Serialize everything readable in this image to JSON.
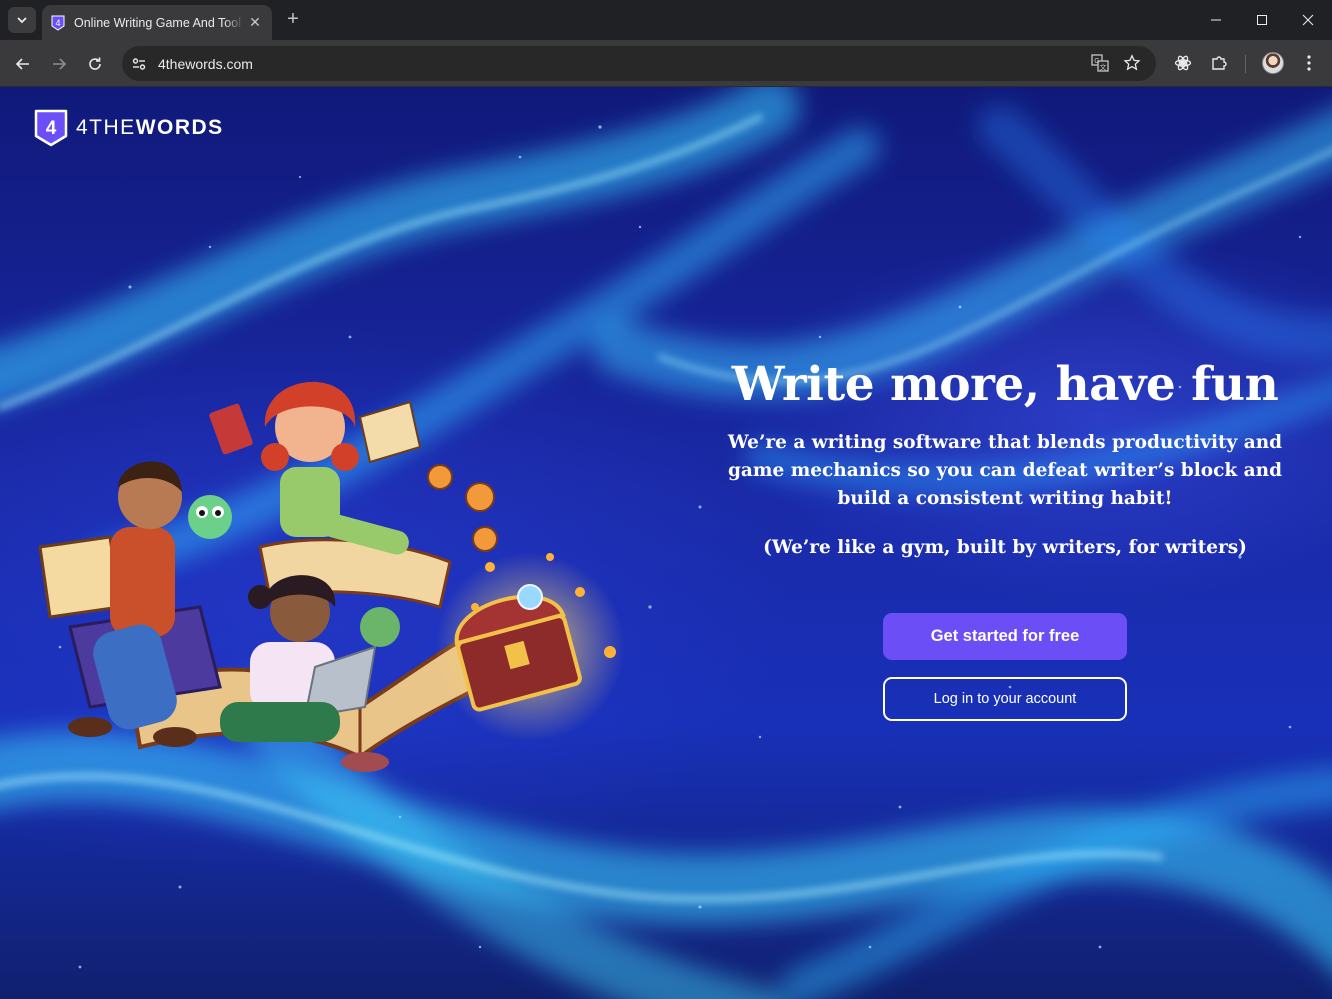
{
  "browser": {
    "tab_title": "Online Writing Game And Tool",
    "url": "4thewords.com",
    "icons": [
      "tab-search-icon",
      "close-icon",
      "plus-icon",
      "minimize-icon",
      "maximize-icon",
      "close-window-icon",
      "back-icon",
      "forward-icon",
      "reload-icon",
      "site-info-icon",
      "translate-icon",
      "star-icon",
      "extension-gear-icon",
      "puzzle-icon",
      "avatar",
      "more-vert-icon"
    ]
  },
  "page": {
    "logo": {
      "prefix": "4THE",
      "suffix": "WORDS",
      "mark": "4"
    },
    "headline": "Write more, have fun",
    "subheadline": "We’re a writing software that blends productivity and game mechanics so you can defeat writer’s block and build a consistent writing habit!",
    "tagline": "(We’re like a gym, built by writers, for writers)",
    "cta_primary": "Get started for free",
    "cta_secondary": "Log in to your account",
    "colors": {
      "accent": "#6b4ef6",
      "background": "#1a2aa8"
    }
  }
}
